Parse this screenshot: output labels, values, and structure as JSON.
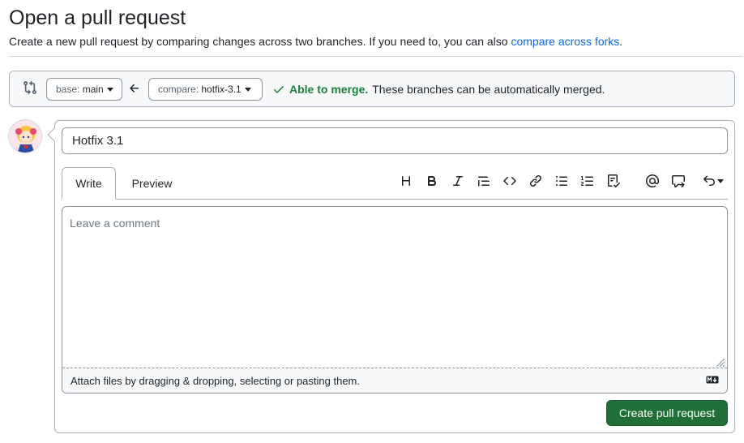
{
  "page": {
    "title": "Open a pull request",
    "subtitle": "Create a new pull request by comparing changes across two branches. If you need to, you can also",
    "subtitle_link": "compare across forks",
    "subtitle_end": "."
  },
  "range": {
    "base_label": "base:",
    "base_value": "main",
    "compare_label": "compare:",
    "compare_value": "hotfix-3.1",
    "merge_status": "Able to merge.",
    "merge_message": "These branches can be automatically merged."
  },
  "form": {
    "title_value": "Hotfix 3.1",
    "tabs": [
      "Write",
      "Preview"
    ],
    "comment_placeholder": "Leave a comment",
    "attach_text": "Attach files by dragging & dropping, selecting or pasting them.",
    "submit_label": "Create pull request"
  },
  "toolbar": [
    "heading-icon",
    "bold-icon",
    "italic-icon",
    "quote-icon",
    "code-icon",
    "link-icon",
    "unordered-list-icon",
    "ordered-list-icon",
    "task-list-icon",
    "mention-icon",
    "reference-icon",
    "undo-icon"
  ],
  "colors": {
    "link": "#0969da",
    "success": "#1a7f37",
    "primary_button": "#1f6f36"
  }
}
